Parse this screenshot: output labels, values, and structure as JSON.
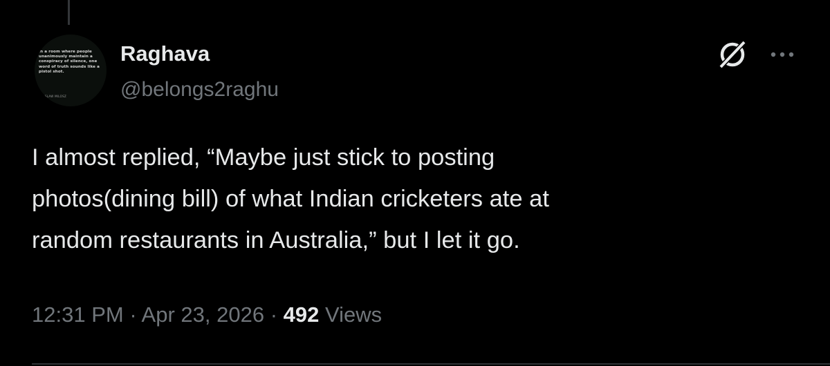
{
  "avatar": {
    "quote": "In a room where people unanimously maintain a conspiracy of silence, one word of truth sounds like a pistol shot.",
    "author": "CZESLAW MILOSZ"
  },
  "user": {
    "display_name": "Raghava",
    "handle": "@belongs2raghu"
  },
  "actions": {
    "grok_icon": "grok-icon",
    "more_icon": "more-horizontal-icon"
  },
  "tweet": {
    "text": "I almost replied, “Maybe just stick to posting\nphotos(dining bill) of what Indian cricketers ate at\nrandom restaurants in Australia,” but I let it go."
  },
  "meta": {
    "time": "12:31 PM",
    "separator": " · ",
    "date": "Apr 23, 2026",
    "views_count": "492",
    "views_label": " Views"
  },
  "colors": {
    "background": "#000000",
    "primary_text": "#e7e9ea",
    "secondary_text": "#71767b",
    "divider": "#2f3336"
  }
}
